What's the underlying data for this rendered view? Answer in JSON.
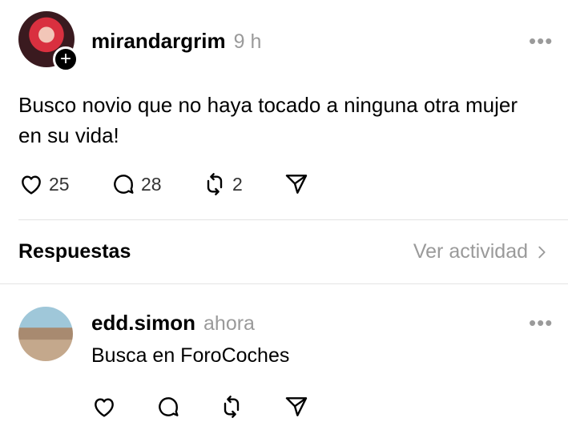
{
  "post": {
    "username": "mirandargrim",
    "time": "9 h",
    "more": "•••",
    "follow_icon": "+",
    "text": "Busco novio que no haya tocado a ninguna otra mujer en su vida!",
    "likes": "25",
    "comments": "28",
    "reposts": "2"
  },
  "replies_section": {
    "title": "Respuestas",
    "activity_link": "Ver actividad"
  },
  "reply": {
    "username": "edd.simon",
    "time": "ahora",
    "more": "•••",
    "text": "Busca en ForoCoches"
  },
  "icons": {
    "like": "heart-icon",
    "comment": "comment-icon",
    "repost": "repost-icon",
    "share": "send-icon",
    "more": "more-icon",
    "follow": "plus-icon",
    "chevron": "chevron-right-icon"
  }
}
